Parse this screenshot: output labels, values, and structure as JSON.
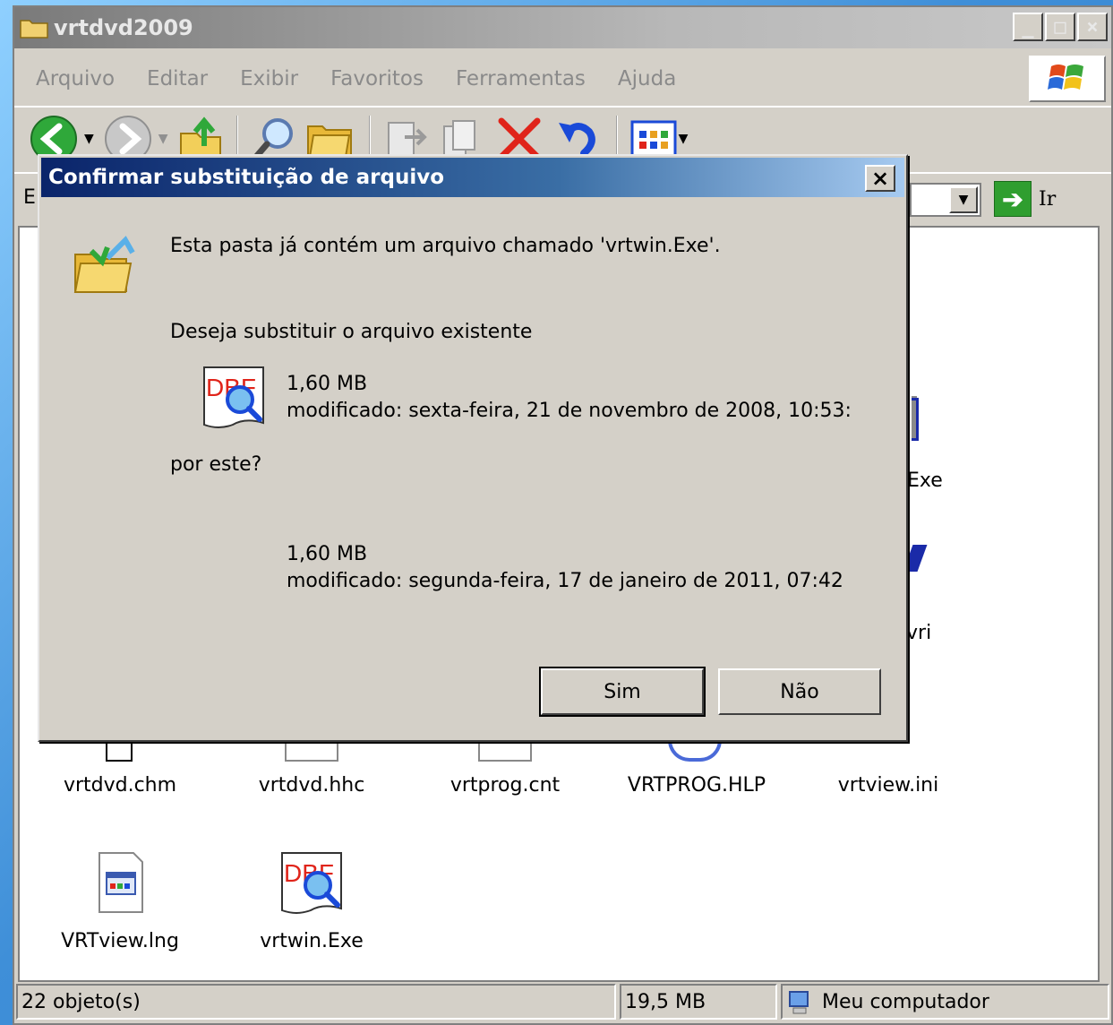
{
  "window": {
    "title": "vrtdvd2009",
    "controls": [
      "_",
      "□",
      "×"
    ]
  },
  "menu": [
    "Arquivo",
    "Editar",
    "Exibir",
    "Favoritos",
    "Ferramentas",
    "Ajuda"
  ],
  "address": {
    "label_fragment": "E",
    "go_label": "Ir"
  },
  "files": [
    {
      "name": "vrtdvd.chm"
    },
    {
      "name": "vrtdvd.hhc"
    },
    {
      "name": "vrtprog.cnt"
    },
    {
      "name": "VRTPROG.HLP"
    },
    {
      "name": "vrtview.ini"
    },
    {
      "name": "VRTview.lng"
    },
    {
      "name": "vrtwin.Exe"
    }
  ],
  "partial_file_labels": [
    ".Exe",
    "vri"
  ],
  "status": {
    "objects": "22 objeto(s)",
    "size": "19,5 MB",
    "location": "Meu computador"
  },
  "dialog": {
    "title": "Confirmar substituição de arquivo",
    "close": "×",
    "message": "Esta pasta já contém um arquivo chamado 'vrtwin.Exe'.",
    "question": "Deseja substituir o arquivo existente",
    "existing": {
      "size": "1,60 MB",
      "modified": "modificado: sexta-feira, 21 de novembro de 2008, 10:53:"
    },
    "by_this": "por este?",
    "new": {
      "size": "1,60 MB",
      "modified": "modificado: segunda-feira, 17 de janeiro de 2011, 07:42"
    },
    "yes_label": "Sim",
    "no_label": "Não"
  },
  "icons": {
    "dbf_text": "DBF"
  },
  "colors": {
    "dialog_title_start": "#0a246a",
    "dialog_title_end": "#a6caf0",
    "face": "#d4d0c8"
  }
}
